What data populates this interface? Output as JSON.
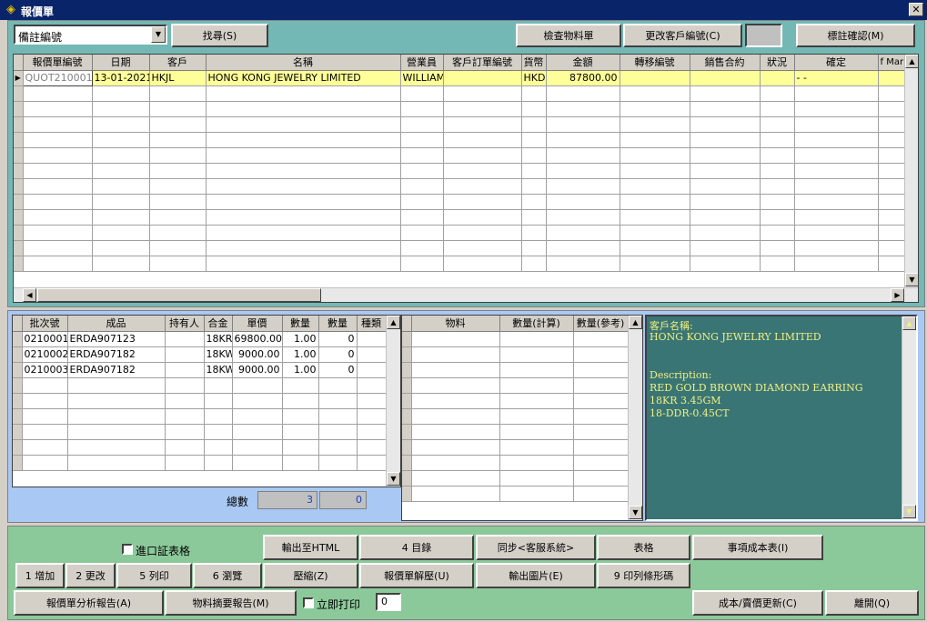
{
  "window": {
    "title": "報價單",
    "app_icon": "quotation-app-icon"
  },
  "toolbar": {
    "dropdown_value": "備註編號",
    "find_label": "找尋(S)",
    "check_material_label": "檢查物料單",
    "change_customer_label": "更改客戶編號(C)",
    "mark_confirm_label": "標註確認(M)"
  },
  "main_table": {
    "headers": [
      "報價單編號",
      "日期",
      "客戶",
      "名稱",
      "營業員",
      "客戶訂單編號",
      "貨幣",
      "金額",
      "轉移編號",
      "銷售合約",
      "狀況",
      "確定",
      "f Mar"
    ],
    "rows": [
      {
        "quote_no": "QUOT210001",
        "date": "13-01-2021",
        "customer": "HKJL",
        "name": "HONG KONG JEWELRY LIMITED",
        "salesman": "WILLIAM",
        "po_no": "",
        "currency": "HKD",
        "amount": "87800.00",
        "transfer_no": "",
        "sales_contract": "",
        "status": "",
        "confirmed": "- -",
        "f_mar": ""
      }
    ]
  },
  "lot_table": {
    "headers": [
      "批次號",
      "成品",
      "持有人",
      "合金",
      "單價",
      "數量",
      "數量",
      "種類"
    ],
    "rows": [
      {
        "lot": "0210001",
        "product": "ERDA907123",
        "holder": "",
        "alloy": "18KR",
        "price": "69800.00",
        "qty": "1.00",
        "qty2": "0",
        "kind": ""
      },
      {
        "lot": "0210002",
        "product": "ERDA907182",
        "holder": "",
        "alloy": "18KW",
        "price": "9000.00",
        "qty": "1.00",
        "qty2": "0",
        "kind": ""
      },
      {
        "lot": "0210003",
        "product": "ERDA907182",
        "holder": "",
        "alloy": "18KW",
        "price": "9000.00",
        "qty": "1.00",
        "qty2": "0",
        "kind": ""
      }
    ],
    "total_label": "總數",
    "total_qty": "3",
    "total_qty2": "0"
  },
  "material_table": {
    "headers": [
      "物料",
      "數量(計算)",
      "數量(參考)"
    ]
  },
  "info_panel": {
    "customer_label": "客戶名稱:",
    "customer_name": "HONG KONG JEWELRY LIMITED",
    "desc_label": "Description:",
    "desc_line1": "RED GOLD BROWN DIAMOND EARRING",
    "desc_line2": "18KR 3.45GM",
    "desc_line3": "18-DDR-0.45CT"
  },
  "bottom": {
    "import_form_label": "進口証表格",
    "export_html": "輸出至HTML",
    "catalog": "4 目錄",
    "sync": "同步<客服系統>",
    "table": "表格",
    "cost_table": "事項成本表(I)",
    "add": "1 增加",
    "modify": "2 更改",
    "print": "5 列印",
    "browse": "6 瀏覽",
    "compress": "壓縮(Z)",
    "decompress": "報價單解壓(U)",
    "export_image": "輸出圖片(E)",
    "print_barcode": "9 印列條形碼",
    "analysis_report": "報價單分析報告(A)",
    "material_summary": "物料摘要報告(M)",
    "print_now_label": "立即打印",
    "print_now_qty": "0",
    "cost_price_update": "成本/賣價更新(C)",
    "exit": "離開(Q)"
  },
  "colors": {
    "teal": "#73b8b4",
    "blue_panel": "#a9c8f4",
    "green_panel": "#8cc99a",
    "info_bg": "#3a7575",
    "info_text": "#f0f080",
    "selected_row": "#ffff99"
  }
}
